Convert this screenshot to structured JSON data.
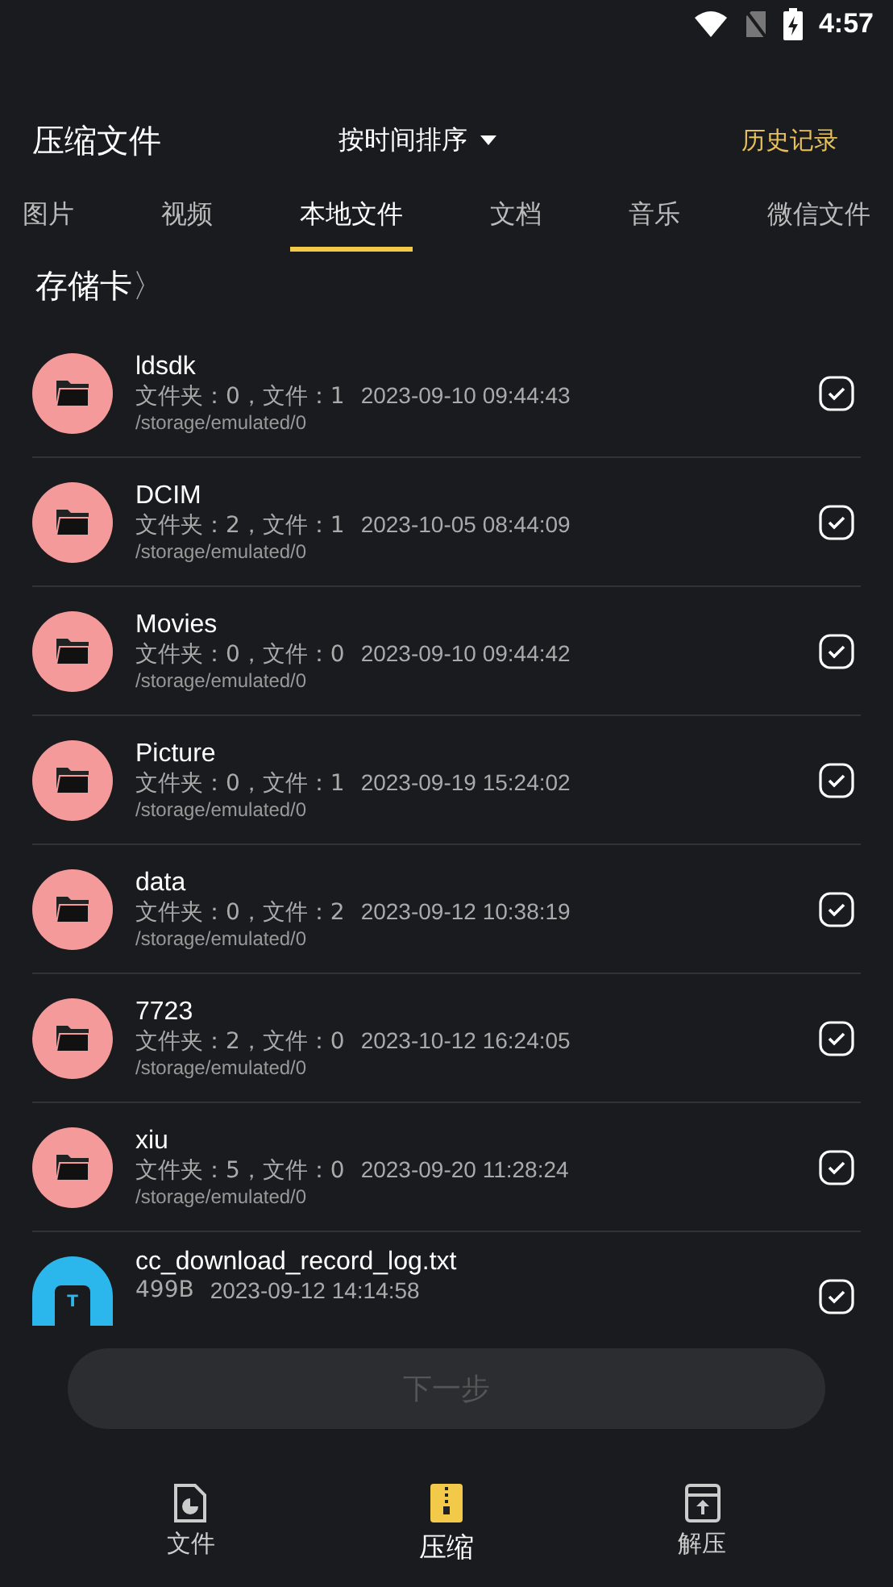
{
  "status_bar": {
    "time": "4:57"
  },
  "header": {
    "title": "压缩文件",
    "sort": "按时间排序",
    "history": "历史记录"
  },
  "tabs": [
    {
      "label": "图片",
      "selected": false
    },
    {
      "label": "视频",
      "selected": false
    },
    {
      "label": "本地文件",
      "selected": true
    },
    {
      "label": "文档",
      "selected": false
    },
    {
      "label": "音乐",
      "selected": false
    },
    {
      "label": "微信文件",
      "selected": false
    }
  ],
  "breadcrumb": {
    "label": "存储卡",
    "chevron": "〉"
  },
  "files": [
    {
      "kind": "folder",
      "name": "ldsdk",
      "info": "文件夹：0，文件：1",
      "date": "2023-09-10 09:44:43",
      "path": "/storage/emulated/0",
      "checked": true
    },
    {
      "kind": "folder",
      "name": "DCIM",
      "info": "文件夹：2，文件：1",
      "date": "2023-10-05 08:44:09",
      "path": "/storage/emulated/0",
      "checked": true
    },
    {
      "kind": "folder",
      "name": "Movies",
      "info": "文件夹：0，文件：0",
      "date": "2023-09-10 09:44:42",
      "path": "/storage/emulated/0",
      "checked": true
    },
    {
      "kind": "folder",
      "name": "Picture",
      "info": "文件夹：0，文件：1",
      "date": "2023-09-19 15:24:02",
      "path": "/storage/emulated/0",
      "checked": true
    },
    {
      "kind": "folder",
      "name": "data",
      "info": "文件夹：0，文件：2",
      "date": "2023-09-12 10:38:19",
      "path": "/storage/emulated/0",
      "checked": true
    },
    {
      "kind": "folder",
      "name": "7723",
      "info": "文件夹：2，文件：0",
      "date": "2023-10-12 16:24:05",
      "path": "/storage/emulated/0",
      "checked": true
    },
    {
      "kind": "folder",
      "name": "xiu",
      "info": "文件夹：5，文件：0",
      "date": "2023-09-20 11:28:24",
      "path": "/storage/emulated/0",
      "checked": true
    },
    {
      "kind": "text",
      "name": "cc_download_record_log.txt",
      "info": "499B",
      "date": "2023-09-12 14:14:58",
      "checked": true,
      "icon_letter": "T"
    }
  ],
  "next_button": {
    "label": "下一步",
    "disabled": true
  },
  "bottom_nav": [
    {
      "label": "文件",
      "selected": false,
      "kind": "file"
    },
    {
      "label": "压缩",
      "selected": true,
      "kind": "zip"
    },
    {
      "label": "解压",
      "selected": false,
      "kind": "unzip"
    }
  ]
}
